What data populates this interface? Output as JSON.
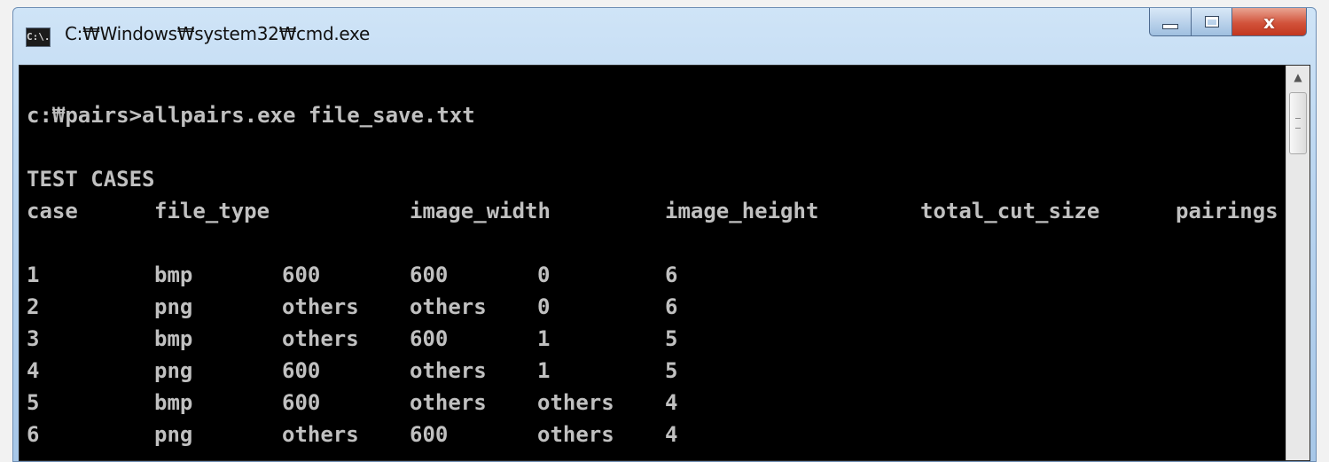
{
  "window": {
    "title": "C:₩Windows₩system32₩cmd.exe",
    "icon": "cmd-icon",
    "icon_text": "C:\\.",
    "buttons": {
      "minimize": "minimize-icon",
      "maximize": "maximize-icon",
      "close_label": "x"
    }
  },
  "console": {
    "command_line": "c:₩pairs>allpairs.exe file_save.txt",
    "section_title": "TEST CASES",
    "headers": [
      "case",
      "file_type",
      "image_width",
      "image_height",
      "total_cut_size",
      "pairings"
    ],
    "rows": [
      [
        "1",
        "bmp",
        "600",
        "600",
        "0",
        "6"
      ],
      [
        "2",
        "png",
        "others",
        "others",
        "0",
        "6"
      ],
      [
        "3",
        "bmp",
        "others",
        "600",
        "1",
        "5"
      ],
      [
        "4",
        "png",
        "600",
        "others",
        "1",
        "5"
      ],
      [
        "5",
        "bmp",
        "600",
        "others",
        "others",
        "4"
      ],
      [
        "6",
        "png",
        "others",
        "600",
        "others",
        "4"
      ]
    ]
  },
  "colors": {
    "console_bg": "#000000",
    "console_text": "#c0c0c0",
    "close_button": "#c9442b"
  }
}
